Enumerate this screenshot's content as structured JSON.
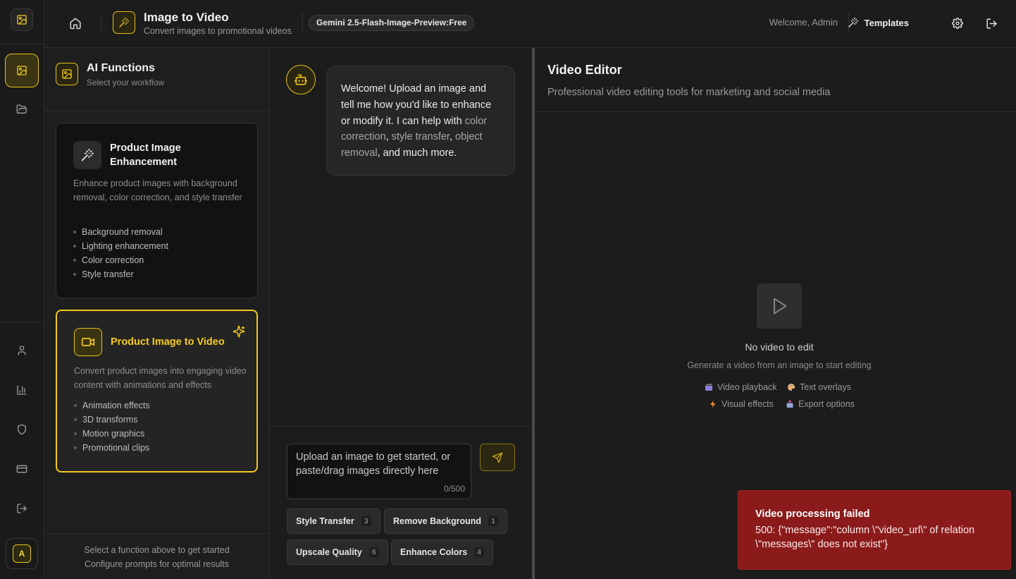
{
  "header": {
    "title": "Image to Video",
    "subtitle": "Convert images to promotional videos",
    "model_badge": "Gemini 2.5-Flash-Image-Preview:Free",
    "welcome": "Welcome, Admin",
    "templates_label": "Templates"
  },
  "functions": {
    "title": "AI Functions",
    "subtitle": "Select your workflow",
    "cards": [
      {
        "title": "Product Image Enhancement",
        "description": "Enhance product images with background removal, color correction, and style transfer",
        "features": [
          "Background removal",
          "Lighting enhancement",
          "Color correction",
          "Style transfer"
        ]
      },
      {
        "title": "Product Image to Video",
        "description": "Convert product images into engaging video content with animations and effects",
        "features": [
          "Animation effects",
          "3D transforms",
          "Motion graphics",
          "Promotional clips"
        ]
      }
    ],
    "footer_line1": "Select a function above to get started",
    "footer_line2": "Configure prompts for optimal results"
  },
  "chat": {
    "welcome_part1": "Welcome! Upload an image and tell me how you'd like to enhance or modify it. I can help with ",
    "welcome_hl1": "color correction",
    "welcome_sep1": ", ",
    "welcome_hl2": "style transfer",
    "welcome_sep2": ", ",
    "welcome_hl3": "object removal",
    "welcome_part2": ", and much more.",
    "input_placeholder": "Upload an image to get started, or paste/drag images directly here",
    "char_count": "0/500",
    "quick_actions": [
      {
        "label": "Style Transfer",
        "count": "3"
      },
      {
        "label": "Remove Background",
        "count": "1"
      },
      {
        "label": "Upscale Quality",
        "count": "6"
      },
      {
        "label": "Enhance Colors",
        "count": "4"
      }
    ]
  },
  "editor": {
    "title": "Video Editor",
    "subtitle": "Professional video editing tools for marketing and social media",
    "empty_title": "No video to edit",
    "empty_subtitle": "Generate a video from an image to start editing",
    "features": [
      "Video playback",
      "Text overlays",
      "Visual effects",
      "Export options"
    ]
  },
  "toast": {
    "title": "Video processing failed",
    "message": "500: {\"message\":\"column \\\"video_url\\\" of relation \\\"messages\\\" does not exist\"}"
  },
  "user": {
    "avatar_initial": "A"
  },
  "colors": {
    "accent": "#f2c81f",
    "background": "#1c1c1c",
    "toast": "#8b1b1b"
  }
}
